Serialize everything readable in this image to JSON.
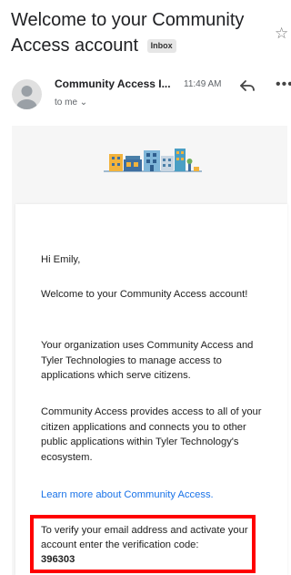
{
  "email": {
    "subject": "Welcome to your Community Access account",
    "label_badge": "Inbox",
    "sender_name": "Community Access I...",
    "time": "11:49 AM",
    "recipient_line": "to me ⌄"
  },
  "icons": {
    "star": "star-icon",
    "reply": "reply-icon",
    "more": "more-icon",
    "avatar": "avatar-icon",
    "logo": "community-buildings-logo"
  },
  "body": {
    "greeting": "Hi Emily,",
    "welcome": "Welcome to your Community Access account!",
    "org_paragraph": "Your organization uses Community Access and Tyler Technologies to manage access to applications which serve citizens.",
    "access_paragraph": "Community Access provides access to all of your citizen applications and connects you to other public applications within Tyler Technology's ecosystem.",
    "learn_more_link": "Learn more about Community Access.",
    "verify_text": "To verify your email address and activate your account enter the verification code:",
    "verification_code": "396303"
  },
  "colors": {
    "link": "#1a73e8",
    "highlight_border": "#ff0000"
  }
}
